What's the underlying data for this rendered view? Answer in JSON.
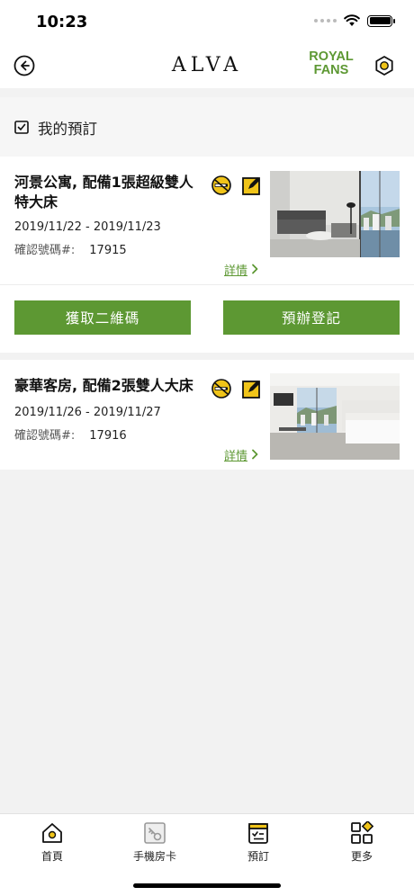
{
  "status_bar": {
    "time": "10:23"
  },
  "header": {
    "brand": "ALVA",
    "royal_fans_line1": "ROYAL",
    "royal_fans_line2": "FANS"
  },
  "section": {
    "title": "我的預訂"
  },
  "bookings": [
    {
      "room_name": "河景公寓, 配備1張超級雙人特大床",
      "dates": "2019/11/22 - 2019/11/23",
      "confirmation_label": "確認號碼#:",
      "confirmation_number": "17915",
      "details_label": "詳情",
      "actions": {
        "qr_code": "獲取二維碼",
        "pre_checkin": "預辦登記"
      }
    },
    {
      "room_name": "豪華客房, 配備2張雙人大床",
      "dates": "2019/11/26 - 2019/11/27",
      "confirmation_label": "確認號碼#:",
      "confirmation_number": "17916",
      "details_label": "詳情"
    }
  ],
  "tab_bar": {
    "items": [
      {
        "label": "首頁",
        "icon": "home-icon"
      },
      {
        "label": "手機房卡",
        "icon": "mobile-key-icon"
      },
      {
        "label": "預訂",
        "icon": "booking-icon"
      },
      {
        "label": "更多",
        "icon": "more-icon"
      }
    ]
  },
  "colors": {
    "accent": "#5d9833",
    "icon_yellow": "#f0c419"
  }
}
